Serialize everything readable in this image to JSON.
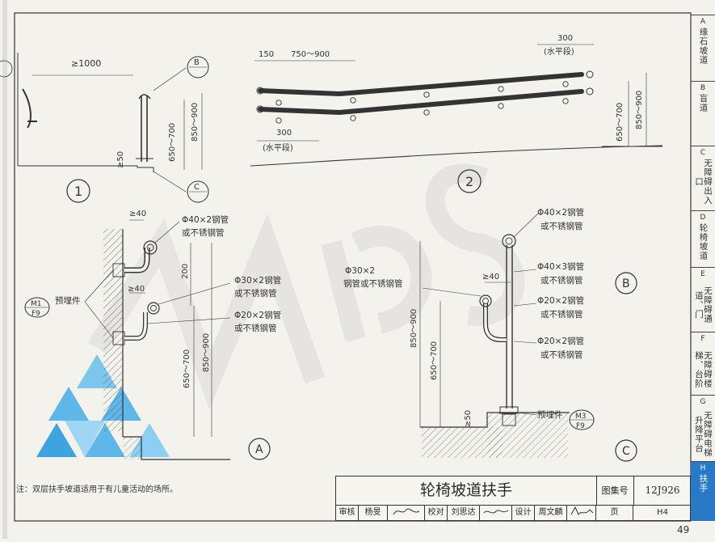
{
  "sidebar": {
    "tabs": [
      {
        "letter": "A",
        "label": "缘石坡道",
        "active": false
      },
      {
        "letter": "B",
        "label": "盲道",
        "active": false
      },
      {
        "letter": "C",
        "label": "无障碍出入口",
        "active": false
      },
      {
        "letter": "D",
        "label": "轮椅坡道",
        "active": false
      },
      {
        "letter": "E",
        "label": "无障碍通道、门",
        "active": false
      },
      {
        "letter": "F",
        "label": "无障碍楼梯、台阶",
        "active": false
      },
      {
        "letter": "G",
        "label": "无障碍电梯升降平台",
        "active": false
      },
      {
        "letter": "H",
        "label": "扶手",
        "active": true
      }
    ]
  },
  "drawing": {
    "d1": {
      "number": "1",
      "dim_min": "≥1000",
      "dim_gap": "≥50",
      "dim_low": "650～700",
      "dim_high": "850～900",
      "callout_b": "B",
      "callout_c": "C"
    },
    "d2": {
      "number": "2",
      "dim_150": "150",
      "dim_750": "750～900",
      "dim_300_top": "300",
      "dim_300_bottom": "300",
      "level_top": "(水平段)",
      "level_bottom": "(水平段)",
      "dim_low": "650～700",
      "dim_high": "850～900"
    },
    "da": {
      "letter": "A",
      "gap_top": "≥40",
      "gap_mid": "≥40",
      "spacing": "200",
      "dim_low": "650～700",
      "dim_high": "850～900",
      "pipe1_a": "Φ40×2钢管",
      "pipe1_b": "或不锈钢管",
      "pipe2_a": "Φ30×2钢管",
      "pipe2_b": "或不锈钢管",
      "pipe3_a": "Φ20×2钢管",
      "pipe3_b": "或不锈钢管",
      "embed_label": "预埋件",
      "ref_top": "M1",
      "ref_bottom": "F9"
    },
    "db": {
      "letter": "B"
    },
    "dc": {
      "letter": "C",
      "gap": "≥40",
      "base_gap": "≥50",
      "dim_high": "850～900",
      "dim_low": "650～700",
      "handrail_a": "Φ30×2",
      "handrail_b": "钢管或不锈钢管",
      "pipe1_a": "Φ40×2钢管",
      "pipe1_b": "或不锈钢管",
      "pipe2_a": "Φ40×3钢管",
      "pipe2_b": "或不锈钢管",
      "pipe3_a": "Φ20×2钢管",
      "pipe3_b": "或不锈钢管",
      "pipe4_a": "Φ20×2钢管",
      "pipe4_b": "或不锈钢管",
      "embed_label": "预埋件",
      "ref_top": "M3",
      "ref_bottom": "F9"
    }
  },
  "note": "注：双层扶手坡道适用于有儿童活动的场所。",
  "title_block": {
    "title": "轮椅坡道扶手",
    "atlas_label": "图集号",
    "atlas_no": "12J926",
    "review_label": "审核",
    "review_name": "杨旻",
    "check_label": "校对",
    "check_name": "刘思达",
    "design_label": "设计",
    "design_name": "周文麟",
    "page_label": "页",
    "page_code": "H4"
  },
  "page_number": "49",
  "colors": {
    "accent": "#2a79c7",
    "ink": "#333333",
    "paper": "#f4f2ec",
    "watermark": "#d9d9d9"
  }
}
